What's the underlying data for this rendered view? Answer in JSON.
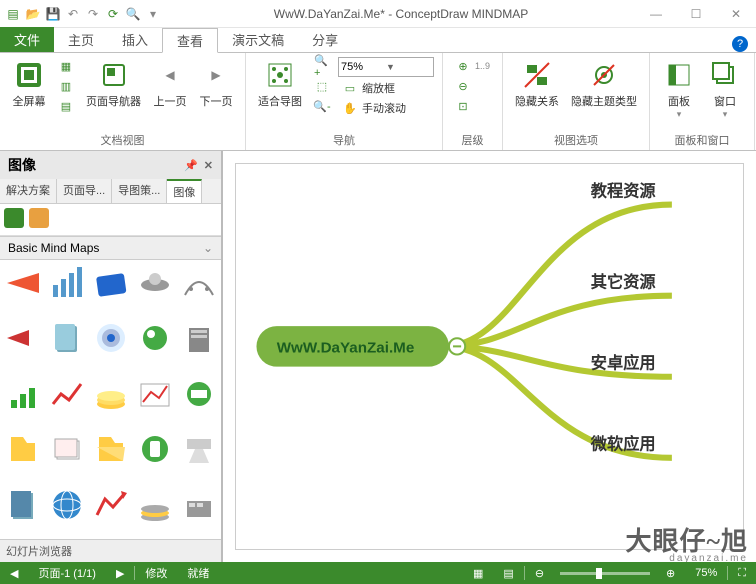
{
  "titlebar": {
    "title": "WwW.DaYanZai.Me* - ConceptDraw MINDMAP"
  },
  "tabs": {
    "file": "文件",
    "home": "主页",
    "insert": "插入",
    "view": "查看",
    "present": "演示文稿",
    "share": "分享"
  },
  "ribbon": {
    "docview": {
      "fullscreen": "全屏幕",
      "navigator": "页面导航器",
      "prev": "上一页",
      "next": "下一页",
      "label": "文档视图"
    },
    "nav": {
      "fit": "适合导图",
      "zoombox": "缩放框",
      "handscroll": "手动滚动",
      "zoom": "75%",
      "label": "导航"
    },
    "level": {
      "label": "层级"
    },
    "viewopt": {
      "hiderel": "隐藏关系",
      "hidetopictype": "隐藏主题类型",
      "label": "视图选项"
    },
    "panels": {
      "panel": "面板",
      "window": "窗口",
      "label": "面板和窗口"
    }
  },
  "sidepanel": {
    "title": "图像",
    "tabs": {
      "solution": "解决方案",
      "pagenav": "页面导...",
      "mapstrat": "导图策...",
      "image": "图像"
    },
    "accordion": "Basic Mind Maps",
    "footer": "幻灯片浏览器"
  },
  "mindmap": {
    "root": "WwW.DaYanZai.Me",
    "branches": [
      "教程资源",
      "其它资源",
      "安卓应用",
      "微软应用"
    ]
  },
  "watermark": {
    "main": "大眼仔~旭",
    "sub": "dayanzai.me"
  },
  "statusbar": {
    "page": "页面-1 (1/1)",
    "modified": "修改",
    "ready": "就绪",
    "zoom": "75%"
  }
}
